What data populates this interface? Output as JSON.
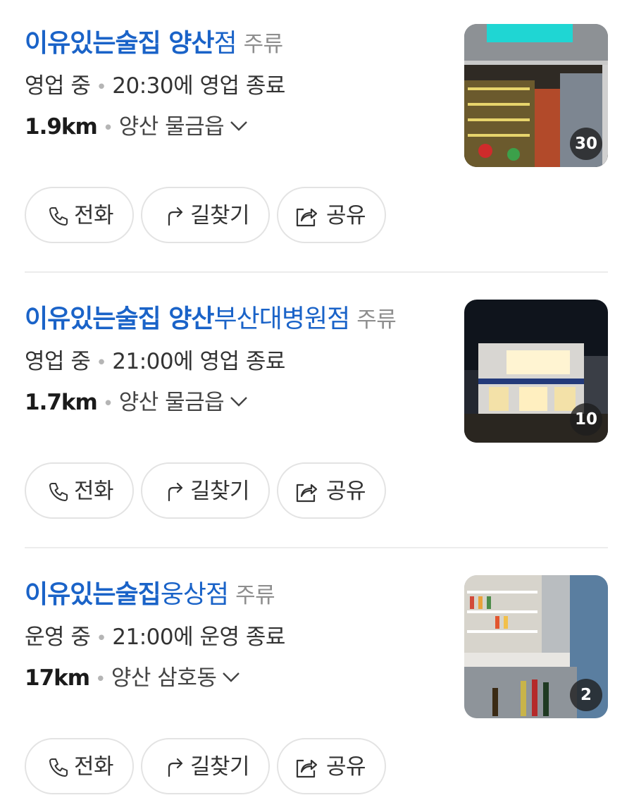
{
  "places": [
    {
      "name_highlight": "이유있는술집 양산",
      "name_rest": "점",
      "category": "주류",
      "status": "영업 중",
      "hours": "20:30에 영업 종료",
      "distance": "1.9km",
      "region": "양산 물금읍",
      "photo_count": "30",
      "photo_icon": "storefront-photo"
    },
    {
      "name_highlight": "이유있는술집 양산",
      "name_rest": "부산대병원점",
      "category": "주류",
      "status": "영업 중",
      "hours": "21:00에 영업 종료",
      "distance": "1.7km",
      "region": "양산 물금읍",
      "photo_count": "10",
      "photo_icon": "night-building-photo"
    },
    {
      "name_highlight": "이유있는술집",
      "name_rest": "웅상점",
      "category": "주류",
      "status": "운영 중",
      "hours": "21:00에 운영 종료",
      "distance": "17km",
      "region": "양산 삼호동",
      "photo_count": "2",
      "photo_icon": "interior-shelves-photo"
    }
  ],
  "actions": {
    "call_label": "전화",
    "directions_label": "길찾기",
    "share_label": "공유",
    "call_icon": "phone-icon",
    "directions_icon": "turn-arrow-icon",
    "share_icon": "share-icon"
  },
  "colors": {
    "title": "#1a63c8",
    "category": "#8e8e8e",
    "text": "#333333",
    "border": "#e3e3e3",
    "divider": "#ececec"
  }
}
